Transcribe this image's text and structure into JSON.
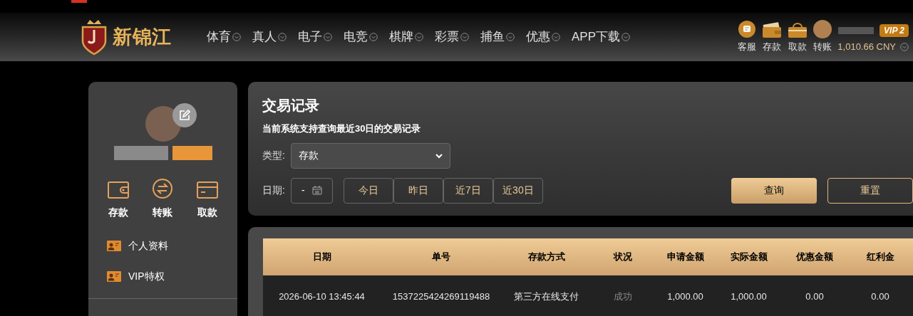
{
  "header": {
    "logo_text": "新锦江",
    "nav": [
      {
        "label": "体育"
      },
      {
        "label": "真人"
      },
      {
        "label": "电子"
      },
      {
        "label": "电竞"
      },
      {
        "label": "棋牌"
      },
      {
        "label": "彩票"
      },
      {
        "label": "捕鱼"
      },
      {
        "label": "优惠"
      },
      {
        "label": "APP下载"
      }
    ],
    "actions": [
      {
        "label": "客服",
        "kind": "chat"
      },
      {
        "label": "存款",
        "kind": "wallet"
      },
      {
        "label": "取款",
        "kind": "safe"
      },
      {
        "label": "转账",
        "kind": "avatar"
      }
    ],
    "vip_badge": "VIP 2",
    "balance": "1,010.66 CNY"
  },
  "sidebar": {
    "quick_actions": [
      {
        "label": "存款",
        "kind": "wallet"
      },
      {
        "label": "转账",
        "kind": "transfer"
      },
      {
        "label": "取款",
        "kind": "card"
      }
    ],
    "menu": [
      {
        "label": "个人资料"
      },
      {
        "label": "VIP特权"
      }
    ]
  },
  "filter": {
    "title": "交易记录",
    "notice": "当前系统支持查询最近30日的交易记录",
    "type_label": "类型:",
    "type_value": "存款",
    "date_label": "日期:",
    "date_value": "-",
    "ranges": [
      {
        "label": "今日"
      },
      {
        "label": "昨日"
      },
      {
        "label": "近7日"
      },
      {
        "label": "近30日"
      }
    ],
    "query_button": "查询",
    "reset_button": "重置"
  },
  "table": {
    "columns": [
      "日期",
      "单号",
      "存款方式",
      "状况",
      "申请金额",
      "实际金额",
      "优惠金额",
      "红利金"
    ],
    "rows": [
      {
        "cells": [
          {
            "text": "2026-06-10 13:45:44",
            "kind": "plain"
          },
          {
            "text": "1537225424269119488",
            "kind": "plain"
          },
          {
            "text": "第三方在线支付",
            "kind": "plain"
          },
          {
            "text": "成功",
            "kind": "status"
          },
          {
            "text": "1,000.00",
            "kind": "plain"
          },
          {
            "text": "1,000.00",
            "kind": "plain"
          },
          {
            "text": "0.00",
            "kind": "plain"
          },
          {
            "text": "0.00",
            "kind": "plain"
          }
        ]
      }
    ]
  }
}
